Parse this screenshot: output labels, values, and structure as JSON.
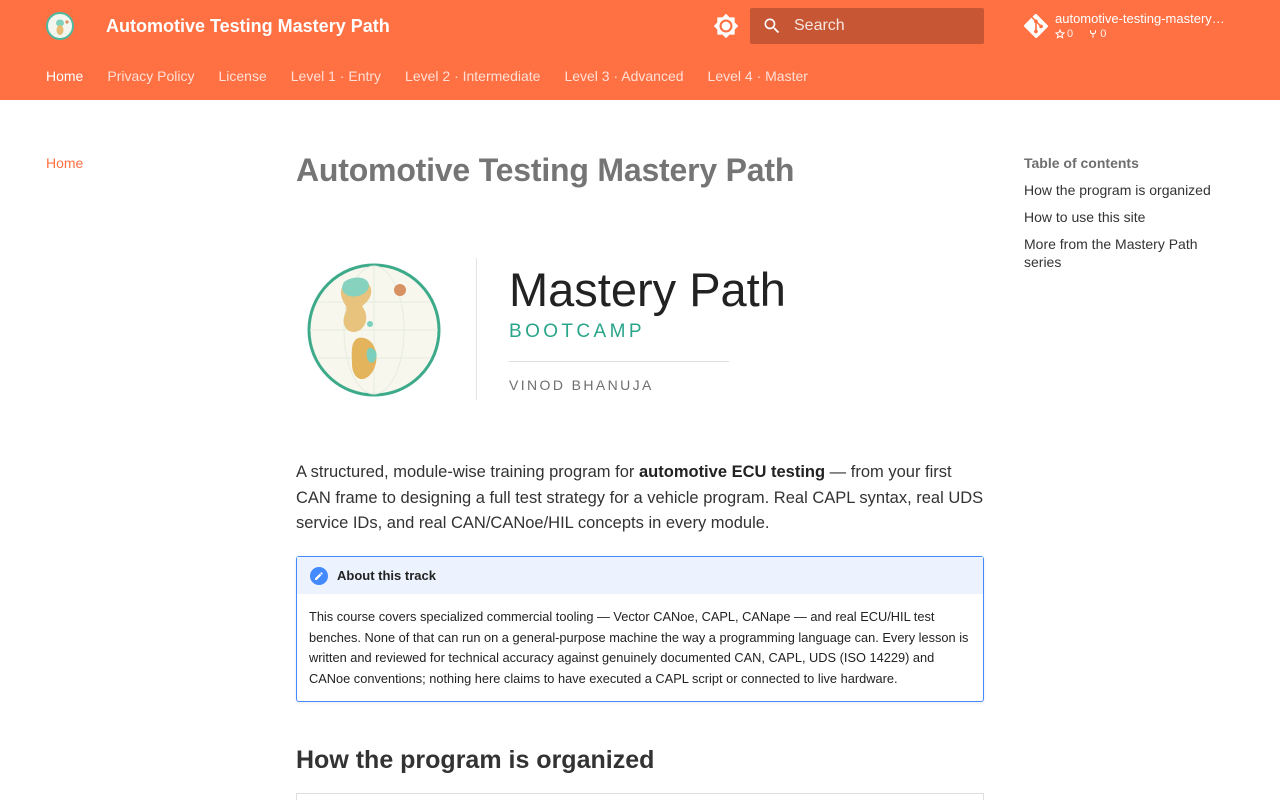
{
  "header": {
    "site_title": "Automotive Testing Mastery Path",
    "search_placeholder": "Search",
    "repo": {
      "name": "automotive-testing-mastery-path",
      "stars": "0",
      "forks": "0"
    },
    "accent_color": "#ff7043"
  },
  "tabs": [
    {
      "label": "Home",
      "active": true
    },
    {
      "label": "Privacy Policy"
    },
    {
      "label": "License"
    },
    {
      "label": "Level 1 · Entry"
    },
    {
      "label": "Level 2 · Intermediate"
    },
    {
      "label": "Level 3 · Advanced"
    },
    {
      "label": "Level 4 · Master"
    }
  ],
  "sidebar": {
    "home_label": "Home"
  },
  "toc": {
    "title": "Table of contents",
    "items": [
      "How the program is organized",
      "How to use this site",
      "More from the Mastery Path series"
    ]
  },
  "main": {
    "title": "Automotive Testing Mastery Path",
    "hero": {
      "title": "Mastery Path",
      "subtitle": "BOOTCAMP",
      "author": "VINOD BHANUJA"
    },
    "intro": {
      "before": "A structured, module-wise training program for ",
      "bold": "automotive ECU testing",
      "after": " — from your first CAN frame to designing a full test strategy for a vehicle program. Real CAPL syntax, real UDS service IDs, and real CAN/CANoe/HIL concepts in every module."
    },
    "admonition": {
      "title": "About this track",
      "body": "This course covers specialized commercial tooling — Vector CANoe, CAPL, CANape — and real ECU/HIL test benches. None of that can run on a general-purpose machine the way a programming language can. Every lesson is written and reviewed for technical accuracy against genuinely documented CAN, CAPL, UDS (ISO 14229) and CANoe conventions; nothing here claims to have executed a CAPL script or connected to live hardware."
    },
    "section_heading": "How the program is organized"
  }
}
